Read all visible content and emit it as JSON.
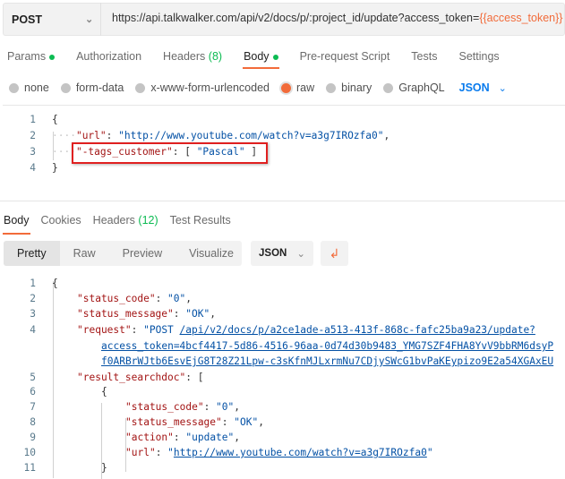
{
  "request": {
    "method": "POST",
    "url_prefix": "https://api.talkwalker.com/api/v2/docs/p/:project_id/update?access_token=",
    "url_var": "{{access_token}}"
  },
  "tabs": [
    {
      "label": "Params"
    },
    {
      "label": "Authorization"
    },
    {
      "label": "Headers",
      "count": "(8)"
    },
    {
      "label": "Body"
    },
    {
      "label": "Pre-request Script"
    },
    {
      "label": "Tests"
    },
    {
      "label": "Settings"
    }
  ],
  "body_types": [
    "none",
    "form-data",
    "x-www-form-urlencoded",
    "raw",
    "binary",
    "GraphQL"
  ],
  "body_format": "JSON",
  "request_body": {
    "ln": [
      "1",
      "2",
      "3",
      "4"
    ],
    "open": "{",
    "close": "}",
    "k1": "\"url\"",
    "v1": "\"http://www.youtube.com/watch?v=a3g7IROzfa0\"",
    "k2": "\"-tags_customer\"",
    "v2": "\"Pascal\""
  },
  "response_tabs": [
    {
      "label": "Body"
    },
    {
      "label": "Cookies"
    },
    {
      "label": "Headers",
      "count": "(12)"
    },
    {
      "label": "Test Results"
    }
  ],
  "view_modes": [
    "Pretty",
    "Raw",
    "Preview",
    "Visualize"
  ],
  "response_format": "JSON",
  "response": {
    "ln": [
      "1",
      "2",
      "3",
      "4",
      "5",
      "6",
      "7",
      "8",
      "9",
      "10",
      "11"
    ],
    "k_status_code": "\"status_code\"",
    "v_status_code": "\"0\"",
    "k_status_message": "\"status_message\"",
    "v_status_message": "\"OK\"",
    "k_request": "\"request\"",
    "v_request_method": "\"POST ",
    "v_request_l1": "/api/v2/docs/p/a2ce1ade-a513-413f-868c-fafc25ba9a23/update?",
    "v_request_l2": "access_token=4bcf4417-5d86-4516-96aa-0d74d30b9483_YMG7SZF4FHA8YvV9bbRM6dsyP",
    "v_request_l3": "f0ARBrWJtb6EsvEjG8T28Z21Lpw-c3sKfnMJLxrmNu7CDjySWcG1bvPaKEypizo9E2a54XGAxEU",
    "k_result": "\"result_searchdoc\"",
    "k_action": "\"action\"",
    "v_action": "\"update\"",
    "k_url": "\"url\"",
    "v_url": "http://www.youtube.com/watch?v=a3g7IROzfa0"
  }
}
